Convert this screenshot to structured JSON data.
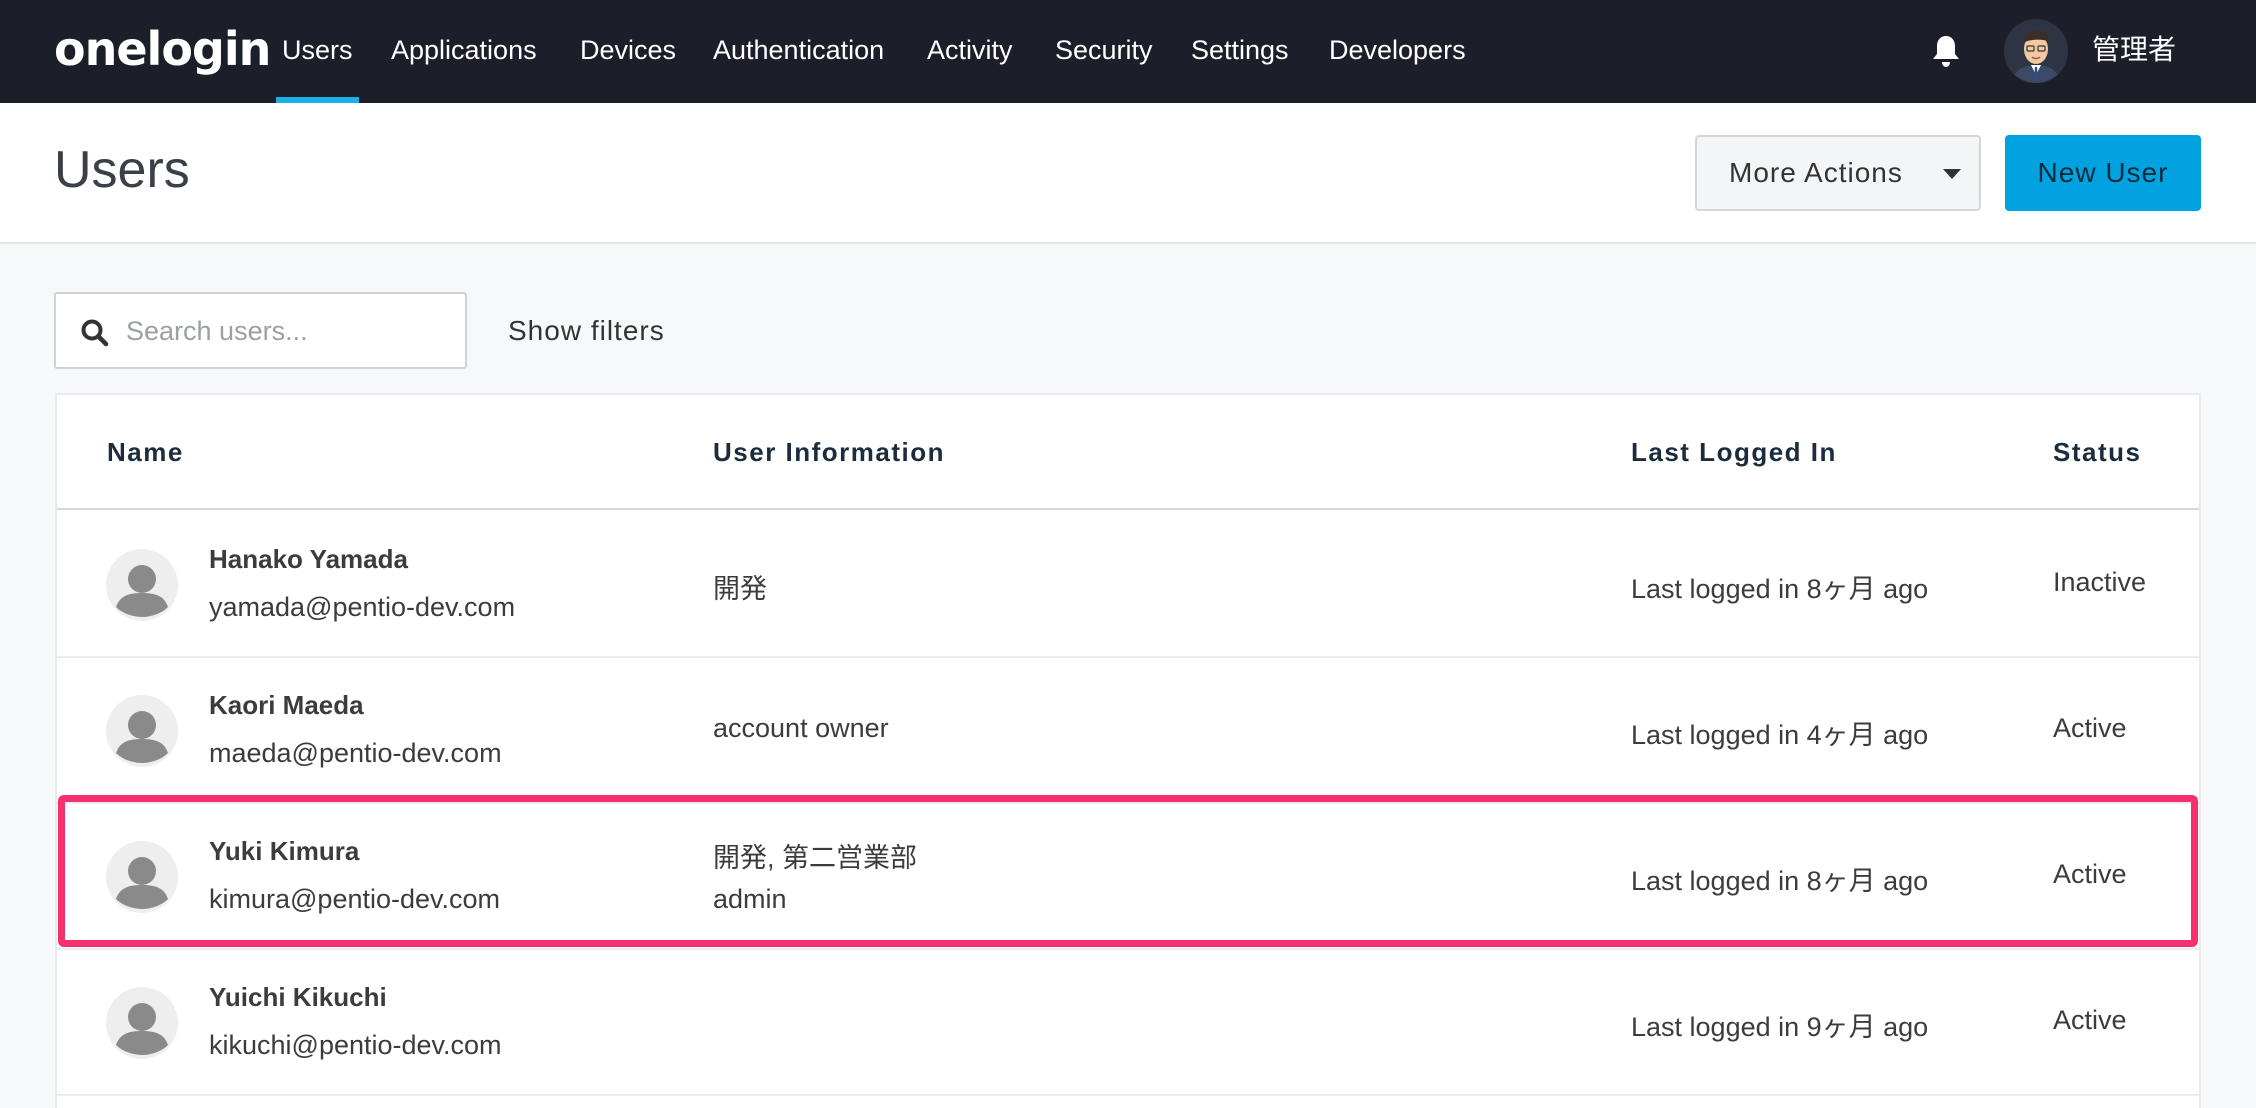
{
  "nav": {
    "logo": "onelogin",
    "items": [
      {
        "label": "Users",
        "active": true
      },
      {
        "label": "Applications"
      },
      {
        "label": "Devices"
      },
      {
        "label": "Authentication"
      },
      {
        "label": "Activity"
      },
      {
        "label": "Security"
      },
      {
        "label": "Settings"
      },
      {
        "label": "Developers"
      }
    ],
    "bell_icon": "bell-icon",
    "user_name": "管理者"
  },
  "header": {
    "title": "Users",
    "more_actions_label": "More Actions",
    "new_user_label": "New User"
  },
  "search": {
    "placeholder": "Search users...",
    "value": "",
    "show_filters_label": "Show filters"
  },
  "table": {
    "columns": [
      "Name",
      "User Information",
      "Last Logged In",
      "Status"
    ],
    "rows": [
      {
        "name": "Hanako Yamada",
        "email": "yamada@pentio-dev.com",
        "info": [
          "開発"
        ],
        "last_login": "Last logged in 8ヶ月 ago",
        "status": "Inactive"
      },
      {
        "name": "Kaori Maeda",
        "email": "maeda@pentio-dev.com",
        "info": [
          "account owner"
        ],
        "last_login": "Last logged in 4ヶ月 ago",
        "status": "Active"
      },
      {
        "name": "Yuki Kimura",
        "email": "kimura@pentio-dev.com",
        "info": [
          "開発, 第二営業部",
          "admin"
        ],
        "last_login": "Last logged in 8ヶ月 ago",
        "status": "Active"
      },
      {
        "name": "Yuichi Kikuchi",
        "email": "kikuchi@pentio-dev.com",
        "info": [],
        "last_login": "Last logged in 9ヶ月 ago",
        "status": "Active"
      }
    ]
  },
  "colors": {
    "nav_bg": "#1c1f2a",
    "accent": "#00a2e0",
    "highlight": "#f5306e"
  }
}
